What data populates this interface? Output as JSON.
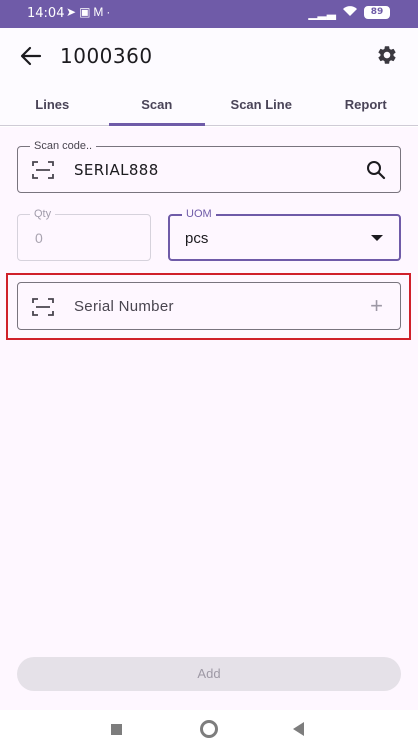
{
  "status_bar": {
    "time": "14:04",
    "notification_icons": [
      "telegram-icon",
      "app-icon",
      "gmail-icon",
      "dot-icon"
    ],
    "battery": "89"
  },
  "header": {
    "title": "1000360"
  },
  "tabs": [
    {
      "label": "Lines",
      "active": false
    },
    {
      "label": "Scan",
      "active": true
    },
    {
      "label": "Scan Line",
      "active": false
    },
    {
      "label": "Report",
      "active": false
    }
  ],
  "scan": {
    "label": "Scan code..",
    "value": "SERIAL888"
  },
  "qty": {
    "label": "Qty",
    "value": "0"
  },
  "uom": {
    "label": "UOM",
    "value": "pcs"
  },
  "serial": {
    "label": "Serial Number"
  },
  "add_button": {
    "label": "Add"
  },
  "colors": {
    "primary": "#6f5ba8",
    "highlight": "#d0202a",
    "background": "#fef7ff"
  }
}
